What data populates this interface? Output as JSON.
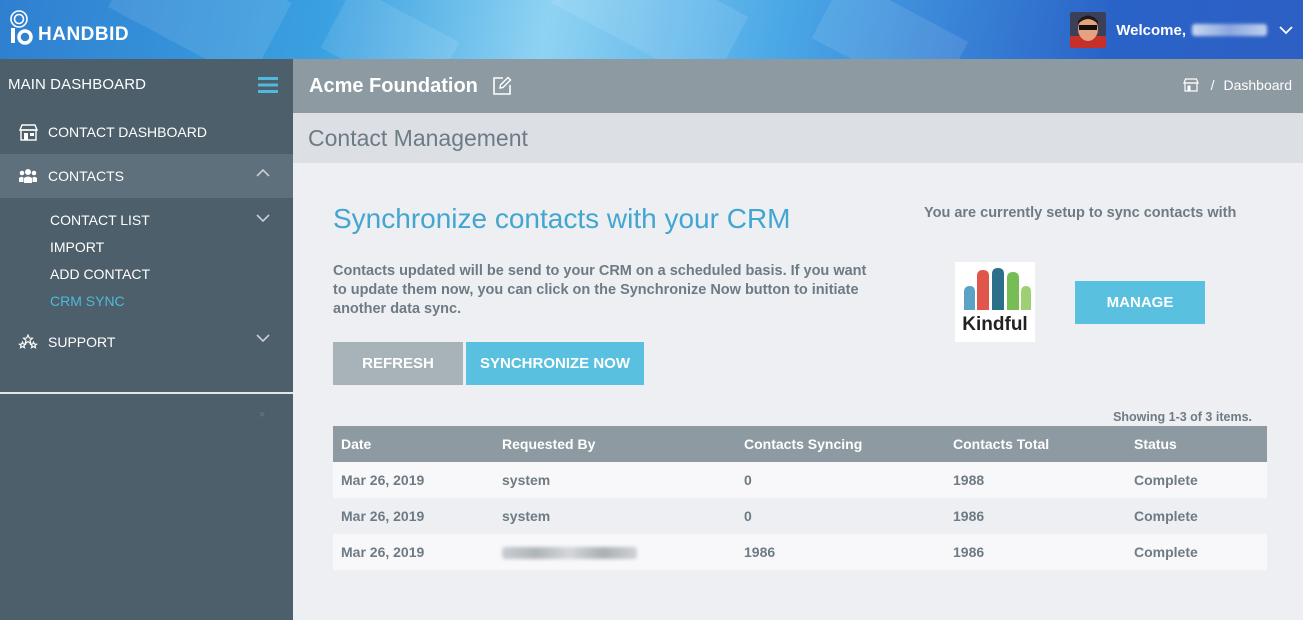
{
  "brand": {
    "name": "HANDBID"
  },
  "user": {
    "welcome_label": "Welcome,"
  },
  "sidebar": {
    "header": "MAIN DASHBOARD",
    "items": [
      {
        "label": "CONTACT DASHBOARD",
        "icon": "storefront-icon"
      },
      {
        "label": "CONTACTS",
        "icon": "group-icon"
      },
      {
        "label": "SUPPORT",
        "icon": "support-icon"
      }
    ],
    "contacts_sub": [
      {
        "label": "CONTACT LIST"
      },
      {
        "label": "IMPORT"
      },
      {
        "label": "ADD CONTACT"
      },
      {
        "label": "CRM SYNC"
      }
    ]
  },
  "page": {
    "org_name": "Acme Foundation",
    "breadcrumb": {
      "current": "Dashboard",
      "separator": "/"
    },
    "section_title": "Contact Management"
  },
  "sync": {
    "title": "Synchronize contacts with your CRM",
    "description": "Contacts updated will be send to your CRM on a scheduled basis. If you want to update them now, you can click on the Synchronize Now button to initiate another data sync.",
    "refresh_label": "REFRESH",
    "sync_now_label": "SYNCHRONIZE NOW",
    "setup_text": "You are currently setup to sync contacts with",
    "crm_name": "Kindful",
    "manage_label": "MANAGE"
  },
  "colors": {
    "accent": "#59c0df",
    "title_blue": "#42a6d0",
    "sidebar_bg": "#4d5f6a",
    "header_gray": "#8d9aa2"
  },
  "table": {
    "summary": "Showing 1-3 of 3 items.",
    "headers": [
      "Date",
      "Requested By",
      "Contacts Syncing",
      "Contacts Total",
      "Status"
    ],
    "rows": [
      {
        "date": "Mar 26, 2019",
        "requested_by": "system",
        "syncing": "0",
        "total": "1988",
        "status": "Complete"
      },
      {
        "date": "Mar 26, 2019",
        "requested_by": "system",
        "syncing": "0",
        "total": "1986",
        "status": "Complete"
      },
      {
        "date": "Mar 26, 2019",
        "requested_by": "",
        "syncing": "1986",
        "total": "1986",
        "status": "Complete"
      }
    ]
  }
}
